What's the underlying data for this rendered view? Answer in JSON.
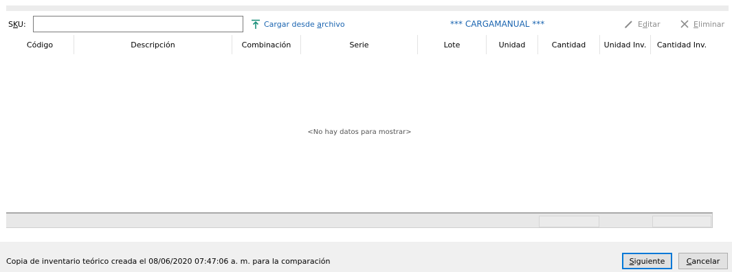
{
  "toolbar": {
    "sku_label_prefix": "S",
    "sku_label_mnemonic": "K",
    "sku_label_suffix": "U:",
    "sku_value": "",
    "load_label_prefix": "Cargar desde ",
    "load_label_mnemonic": "a",
    "load_label_suffix": "rchivo",
    "carga_label": "*** CARGAMANUAL ***",
    "edit_prefix": "E",
    "edit_mnemonic": "d",
    "edit_suffix": "itar",
    "delete_mnemonic": "E",
    "delete_suffix": "liminar"
  },
  "grid": {
    "columns": [
      {
        "label": "Código"
      },
      {
        "label": "Descripción"
      },
      {
        "label": "Combinación"
      },
      {
        "label": "Serie"
      },
      {
        "label": "Lote"
      },
      {
        "label": "Unidad"
      },
      {
        "label": "Cantidad"
      },
      {
        "label": "Unidad Inv."
      },
      {
        "label": "Cantidad Inv."
      }
    ],
    "empty_message": "<No hay datos para mostrar>"
  },
  "status": {
    "text": "Copia de inventario teórico creada el 08/06/2020 07:47:06 a. m. para la comparación"
  },
  "buttons": {
    "next_mnemonic": "S",
    "next_suffix": "iguiente",
    "cancel_mnemonic": "C",
    "cancel_suffix": "ancelar"
  },
  "colors": {
    "accent": "#1a64b0",
    "disabled": "#8c8c8c",
    "focus": "#0078d7"
  }
}
